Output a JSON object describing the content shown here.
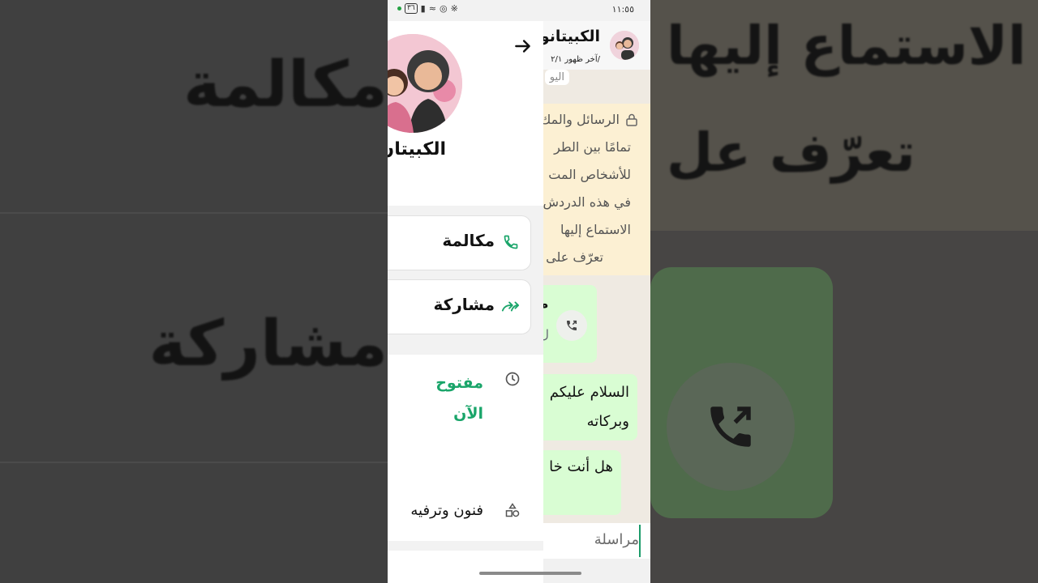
{
  "background": {
    "left_text_1": "مكالمة",
    "left_text_2": "مشاركة",
    "right_text_1": "الاستماع إليها",
    "right_text_2": "تعرّف عل"
  },
  "status_bar": {
    "time": "١١:٥٥",
    "battery": "٣٦"
  },
  "chat": {
    "contact_name": "الكبيتانو",
    "last_seen": "آخر ظهور ٢/١/",
    "date_chip": "اليو",
    "notice_lines": [
      "الرسائل والمك",
      "تمامًا بين الطر",
      "للأشخاص المت",
      "في هذه الدردش",
      "الاستماع إليها",
      "تعرّف على"
    ],
    "call_bubble": {
      "title": "م",
      "subtitle": "ل"
    },
    "messages": [
      {
        "lines": [
          "السلام عليكم",
          "وبركاته"
        ]
      },
      {
        "lines": [
          "هل أنت خا"
        ]
      }
    ],
    "composer_placeholder": "مراسلة"
  },
  "drawer": {
    "profile_name": "الكبيتان",
    "actions": [
      {
        "label": "مكالمة",
        "icon": "phone-icon"
      },
      {
        "label": "مشاركة",
        "icon": "forward-icon"
      }
    ],
    "hours_status_line1": "مفتوح",
    "hours_status_line2": "الآن",
    "category": "فنون وترفيه"
  },
  "colors": {
    "accent_green": "#1aa56a",
    "bubble_green": "#d9fdd3",
    "notice_bg": "#fcf0d3"
  }
}
